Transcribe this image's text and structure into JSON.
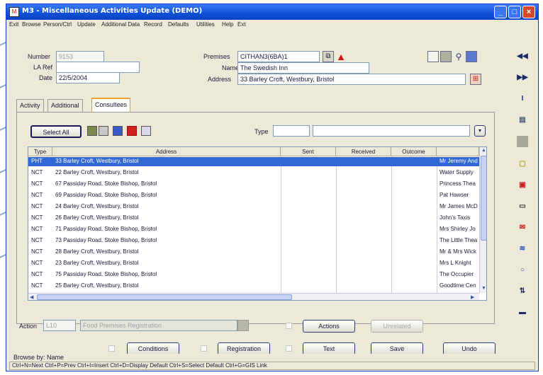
{
  "window": {
    "title": "M3 - Miscellaneous Activities Update (DEMO)"
  },
  "menu": [
    "Exit",
    "Browse",
    "Person/Ctrl",
    "Update",
    "Additional Data",
    "Record",
    "Defaults",
    "Utilities",
    "Help",
    "Ext"
  ],
  "form": {
    "number_label": "Number",
    "number_value": "9153",
    "la_ref_label": "LA Ref",
    "la_ref_value": "",
    "date_label": "Date",
    "date_value": "22/5/2004",
    "premises_label": "Premises",
    "premises_value": "CITHAN3(6BA)1",
    "name_label": "Name",
    "name_value": "The Swedish Inn",
    "address_label": "Address",
    "address_value": "33 Barley Croft, Westbury, Bristol"
  },
  "tabs": [
    {
      "label": "Activity"
    },
    {
      "label": "Additional"
    },
    {
      "label": "Consultees"
    }
  ],
  "toolbar": {
    "select_all": "Select All",
    "type_label": "Type",
    "type_value": "",
    "type_desc": ""
  },
  "grid": {
    "columns": [
      "Type",
      "Address",
      "Sent",
      "Received",
      "Outcome",
      ""
    ],
    "rows": [
      {
        "type": "PHT",
        "address": "33 Barley Croft, Westbury, Bristol",
        "sent": "",
        "received": "",
        "outcome": "",
        "name": "Mr Jeremy And"
      },
      {
        "type": "NCT",
        "address": "22 Barley Croft, Westbury, Bristol",
        "sent": "",
        "received": "",
        "outcome": "",
        "name": "Water Supply"
      },
      {
        "type": "NCT",
        "address": "67 Passiday Road, Stoke Bishop, Bristol",
        "sent": "",
        "received": "",
        "outcome": "",
        "name": "Princess Thea"
      },
      {
        "type": "NCT",
        "address": "69 Passiday Road, Stoke Bishop, Bristol",
        "sent": "",
        "received": "",
        "outcome": "",
        "name": "Pat Hawser"
      },
      {
        "type": "NCT",
        "address": "24 Barley Croft, Westbury, Bristol",
        "sent": "",
        "received": "",
        "outcome": "",
        "name": "Mr James McD"
      },
      {
        "type": "NCT",
        "address": "26 Barley Croft, Westbury, Bristol",
        "sent": "",
        "received": "",
        "outcome": "",
        "name": "John's Taxis"
      },
      {
        "type": "NCT",
        "address": "71 Passiday Road, Stoke Bishop, Bristol",
        "sent": "",
        "received": "",
        "outcome": "",
        "name": "Mrs Shirley Jo"
      },
      {
        "type": "NCT",
        "address": "73 Passiday Road, Stoke Bishop, Bristol",
        "sent": "",
        "received": "",
        "outcome": "",
        "name": "The Little Thea"
      },
      {
        "type": "NCT",
        "address": "28 Barley Croft, Westbury, Bristol",
        "sent": "",
        "received": "",
        "outcome": "",
        "name": "Mr & Mrs Wick"
      },
      {
        "type": "NCT",
        "address": "23 Barley Croft, Westbury, Bristol",
        "sent": "",
        "received": "",
        "outcome": "",
        "name": "Mrs L Knight"
      },
      {
        "type": "NCT",
        "address": "75 Passiday Road, Stoke Bishop, Bristol",
        "sent": "",
        "received": "",
        "outcome": "",
        "name": "The Occupier"
      },
      {
        "type": "NCT",
        "address": "25 Barley Croft, Westbury, Bristol",
        "sent": "",
        "received": "",
        "outcome": "",
        "name": "Goodtime Cen"
      }
    ]
  },
  "action": {
    "label": "Action",
    "code": "L10",
    "description": "Food Premises Registration",
    "actions_button": "Actions",
    "unrelated_button": "Unrelated"
  },
  "buttons": {
    "conditions": "Conditions",
    "registration": "Registration",
    "text": "Text",
    "save": "Save",
    "undo": "Undo"
  },
  "status": {
    "browse": "Browse by: Name",
    "keys": "Ctrl+N=Next  Ctrl+P=Prev  Ctrl+I=Insert  Ctrl+D=Display Default  Ctrl+S=Select Default  Ctrl+G=GIS Link"
  },
  "colors": {
    "titlebar": "#0f4fd6",
    "selection": "#3168d5",
    "active_tab": "#f0a030",
    "window_bg": "#ece9d8"
  }
}
